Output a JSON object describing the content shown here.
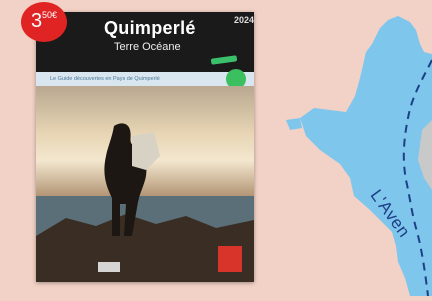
{
  "price": {
    "main": "3",
    "cents": "50€"
  },
  "guide": {
    "title": "Quimperlé",
    "subtitle": "Terre Océane",
    "year": "2024",
    "strip_text": "Le Guide découvertes en Pays de Quimperlé"
  },
  "map": {
    "river_label": "L'Aven",
    "colors": {
      "land": "#f2d2c6",
      "water": "#7fc6ec",
      "route": "#1d3f86",
      "grey_area": "#c9c9c9"
    }
  }
}
